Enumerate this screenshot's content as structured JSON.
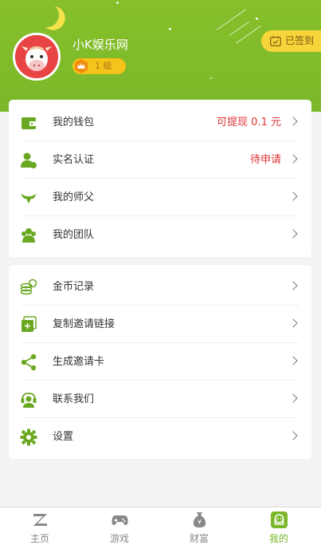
{
  "header": {
    "username": "小K娱乐网",
    "level": "1 级",
    "checkin_label": "已签到"
  },
  "colors": {
    "brand_green": "#7bb82a",
    "accent_red": "#e03434",
    "badge_yellow": "#f6c31a"
  },
  "section1": {
    "items": [
      {
        "label": "我的钱包",
        "value": "可提现 0.1 元",
        "icon": "wallet-icon"
      },
      {
        "label": "实名认证",
        "value": "待申请",
        "icon": "user-verify-icon"
      },
      {
        "label": "我的师父",
        "value": "",
        "icon": "master-icon"
      },
      {
        "label": "我的团队",
        "value": "",
        "icon": "team-icon"
      }
    ]
  },
  "section2": {
    "items": [
      {
        "label": "金币记录",
        "icon": "coins-icon"
      },
      {
        "label": "复制邀请链接",
        "icon": "copy-link-icon"
      },
      {
        "label": "生成邀请卡",
        "icon": "share-icon"
      },
      {
        "label": "联系我们",
        "icon": "headset-icon"
      },
      {
        "label": "设置",
        "icon": "gear-icon"
      }
    ]
  },
  "tabbar": {
    "tabs": [
      {
        "label": "主页",
        "icon": "home-z-icon"
      },
      {
        "label": "游戏",
        "icon": "gamepad-icon"
      },
      {
        "label": "财富",
        "icon": "money-bag-icon"
      },
      {
        "label": "我的",
        "icon": "profile-icon",
        "active": true
      }
    ]
  }
}
